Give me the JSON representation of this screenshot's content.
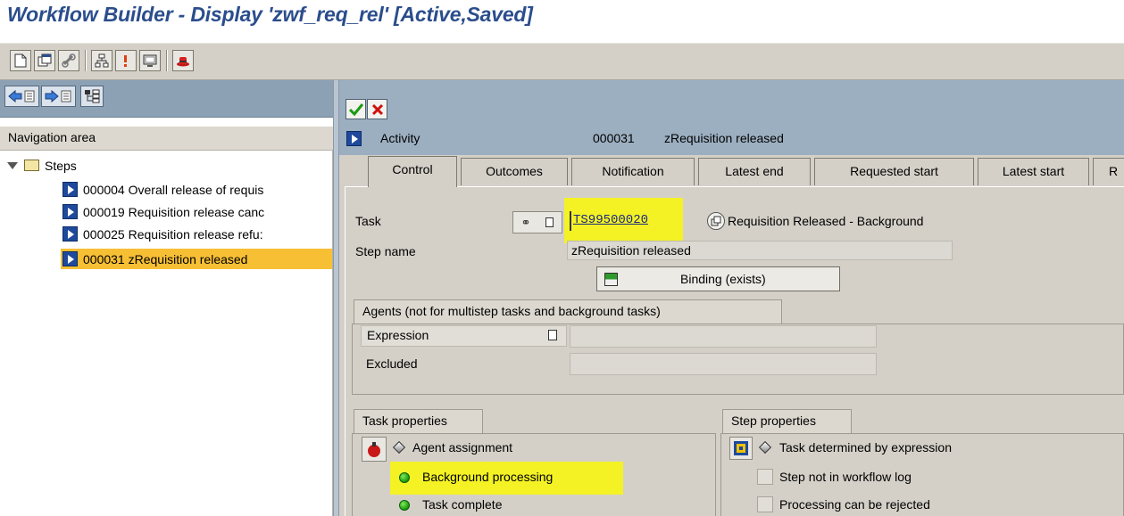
{
  "window": {
    "title": "Workflow Builder - Display 'zwf_req_rel' [Active,Saved]"
  },
  "toolbar": {
    "buttons": [
      "new-document-icon",
      "copy-window-icon",
      "link-icon",
      "structure-icon",
      "info-icon",
      "screen-icon",
      "hat-icon"
    ]
  },
  "nav": {
    "header": "Navigation area",
    "root_label": "Steps",
    "items": [
      {
        "label": "000004 Overall release of requis"
      },
      {
        "label": "000019 Requisition release canc"
      },
      {
        "label": "000025 Requisition release refu:"
      },
      {
        "label": "000031 zRequisition released"
      }
    ],
    "selected_index": 3
  },
  "detail": {
    "type_label": "Activity",
    "step_number": "000031",
    "step_title": "zRequisition released",
    "tabs": [
      "Control",
      "Outcomes",
      "Notification",
      "Latest end",
      "Requested start",
      "Latest start",
      "R"
    ],
    "active_tab": "Control",
    "task_label": "Task",
    "task_id": "TS99500020",
    "task_desc": "Requisition Released - Background",
    "step_name_label": "Step name",
    "step_name_value": "zRequisition released",
    "binding_label": "Binding (exists)",
    "agents_title": "Agents (not for multistep tasks and background tasks)",
    "expression_label": "Expression",
    "excluded_label": "Excluded",
    "task_props_title": "Task properties",
    "task_props": {
      "agent_assignment": "Agent assignment",
      "background_processing": "Background processing",
      "task_complete": "Task complete"
    },
    "step_props_title": "Step properties",
    "step_props": {
      "task_determined": "Task determined by expression",
      "not_in_log": "Step not in workflow log",
      "can_be_rejected": "Processing can be rejected"
    }
  },
  "colors": {
    "title": "#2b4d8c",
    "highlight": "#f4f224",
    "selection": "#f7bf34",
    "panel_blue": "#9cafc1"
  }
}
